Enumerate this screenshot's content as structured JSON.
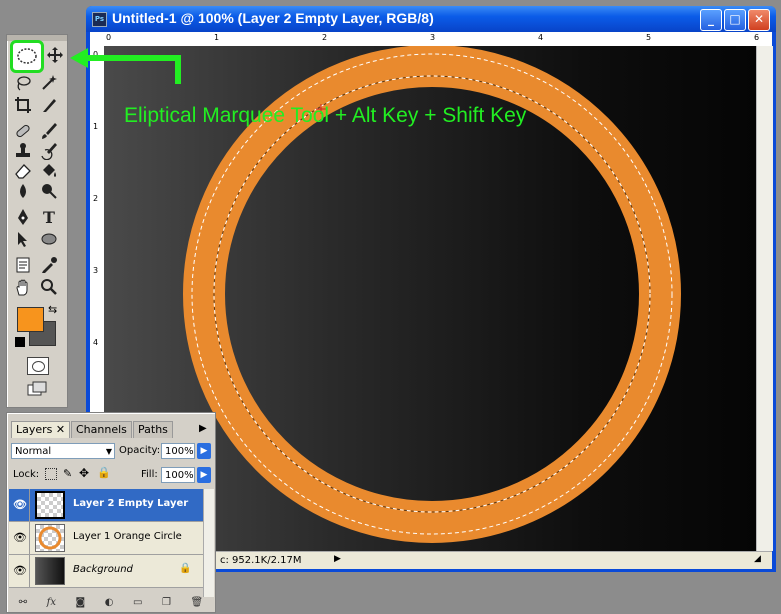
{
  "document": {
    "title": "Untitled-1 @ 100% (Layer 2 Empty Layer, RGB/8)",
    "app_icon_label": "Ps",
    "status": "c: 952.1K/2.17M",
    "ruler_top_ticks": [
      "0",
      "1",
      "2",
      "3",
      "4",
      "5",
      "6"
    ],
    "ruler_left_ticks": [
      "0",
      "1",
      "2",
      "3",
      "4"
    ]
  },
  "annotation": {
    "text": "Eliptical Marquee Tool + Alt Key + Shift Key",
    "color": "#22ee22"
  },
  "toolbox": {
    "active_tool": "elliptical-marquee-icon",
    "foreground_color": "#f7941d",
    "background_color": "#555555"
  },
  "layers_panel": {
    "tabs": [
      "Layers",
      "Channels",
      "Paths"
    ],
    "active_tab": "Layers",
    "blend_mode": "Normal",
    "opacity_label": "Opacity:",
    "opacity": "100%",
    "lock_label": "Lock:",
    "fill_label": "Fill:",
    "fill": "100%",
    "layers": [
      {
        "name": "Layer 2 Empty Layer",
        "selected": true
      },
      {
        "name": "Layer 1 Orange Circle",
        "selected": false
      },
      {
        "name": "Background",
        "selected": false
      }
    ]
  },
  "colors": {
    "ring": "#e98a2e",
    "selection_highlight": "#22dd22",
    "selected_layer": "#316ac5"
  }
}
